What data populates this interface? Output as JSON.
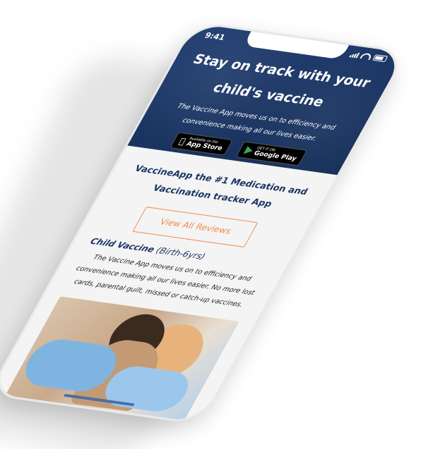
{
  "status": {
    "time": "9:41"
  },
  "hero": {
    "title": "Stay on track with your child's vaccine",
    "text": "The Vaccine App moves us on to efficiency and convenience making all our lives easier."
  },
  "badges": {
    "appstore_small": "Available on the",
    "appstore_big": "App Store",
    "googleplay_small": "GET IT ON",
    "googleplay_big": "Google Play"
  },
  "content": {
    "headline": "VaccineApp the #1 Medication and Vaccination tracker App",
    "reviews_button": "View All Reviews",
    "section_title": "Child Vaccine",
    "section_range": "(Birth-6yrs)",
    "section_text": "The Vaccine App moves us on to efficiency and convenience making all our lives easier. No more lost cards, parental guilt, missed or catch-up vaccines."
  },
  "colors": {
    "brand_navy": "#1b3563",
    "accent_orange": "#f08a4b"
  },
  "icons": {
    "apple": "apple-icon",
    "google_play": "google-play-icon"
  }
}
